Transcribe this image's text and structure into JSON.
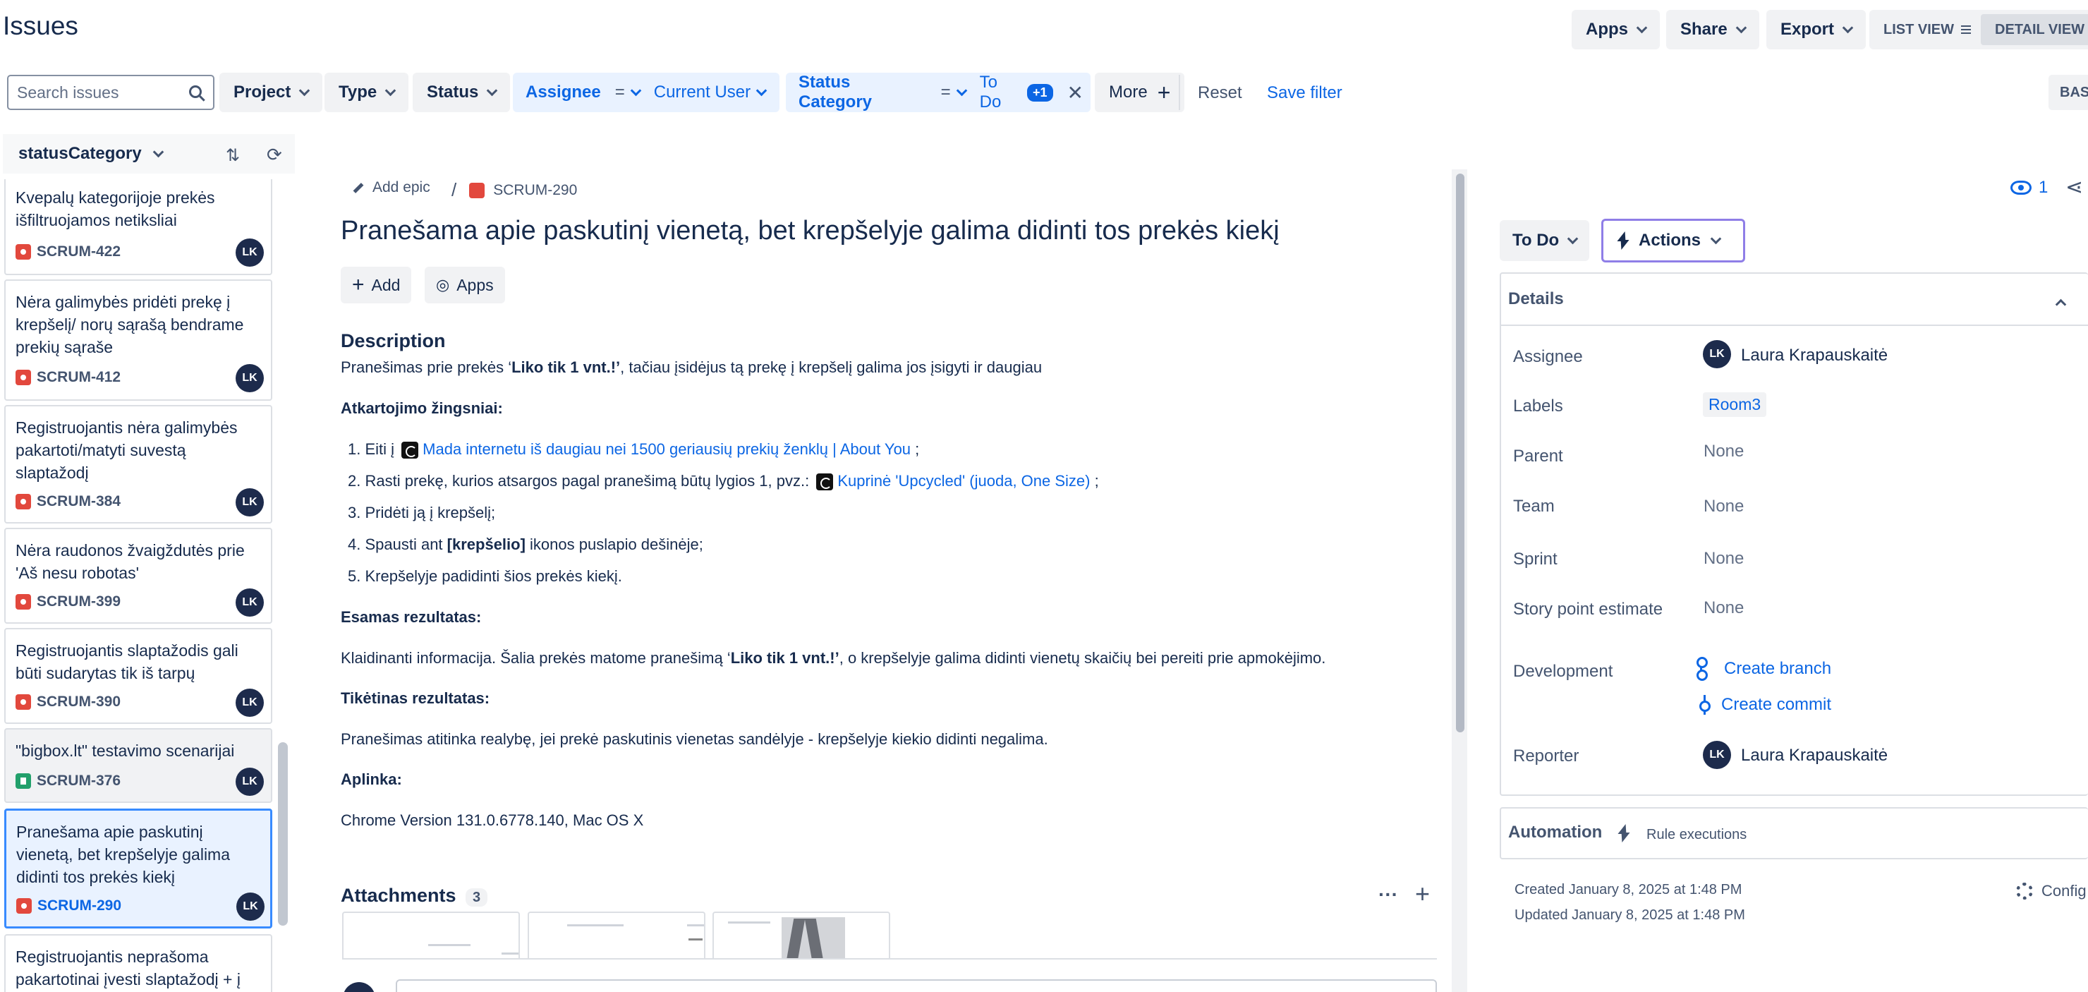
{
  "header": {
    "title": "Issues",
    "apps": "Apps",
    "share": "Share",
    "export": "Export",
    "list_view": "LIST VIEW",
    "detail_view": "DETAIL VIEW"
  },
  "filters": {
    "search_placeholder": "Search issues",
    "project": "Project",
    "type": "Type",
    "status": "Status",
    "assignee_field": "Assignee",
    "assignee_op": "=",
    "assignee_value": "Current User",
    "statuscat_field": "Status Category",
    "statuscat_op": "=",
    "statuscat_value": "To Do",
    "statuscat_more": "+1",
    "more": "More",
    "reset": "Reset",
    "save_filter": "Save filter",
    "basic": "BAS"
  },
  "left_panel": {
    "group_by": "statusCategory",
    "issues": [
      {
        "title": "Kvepalų kategorijoje prekės išfiltruojamos netiksliai",
        "key": "SCRUM-422",
        "type": "bug",
        "assignee": "LK"
      },
      {
        "title": "Nėra galimybės pridėti prekę į krepšelį/ norų sąrašą bendrame prekių sąraše",
        "key": "SCRUM-412",
        "type": "bug",
        "assignee": "LK"
      },
      {
        "title": "Registruojantis nėra galimybės pakartoti/matyti suvestą slaptažodį",
        "key": "SCRUM-384",
        "type": "bug",
        "assignee": "LK"
      },
      {
        "title": "Nėra raudonos žvaigždutės prie 'Aš nesu robotas'",
        "key": "SCRUM-399",
        "type": "bug",
        "assignee": "LK"
      },
      {
        "title": "Registruojantis slaptažodis gali būti sudarytas tik iš tarpų",
        "key": "SCRUM-390",
        "type": "bug",
        "assignee": "LK"
      },
      {
        "title": "\"bigbox.lt\" testavimo scenarijai",
        "key": "SCRUM-376",
        "type": "story",
        "assignee": "LK"
      },
      {
        "title": "Pranešama apie paskutinį vienetą, bet krepšelyje galima didinti tos prekės kiekį",
        "key": "SCRUM-290",
        "type": "bug",
        "assignee": "LK"
      },
      {
        "title": "Registruojantis neprašoma pakartotinai įvesti slaptažodį + į",
        "key": "",
        "type": "bug",
        "assignee": ""
      }
    ]
  },
  "issue": {
    "add_epic": "Add epic",
    "separator": "/",
    "key": "SCRUM-290",
    "title": "Pranešama apie paskutinį vienetą, bet krepšelyje galima didinti tos prekės kiekį",
    "add_btn": "Add",
    "apps_btn": "Apps",
    "description_heading": "Description",
    "desc_p1_a": "Pranešimas prie prekės ‘",
    "desc_p1_b": "Liko tik 1 vnt.!’",
    "desc_p1_c": ", tačiau įsidėjus tą prekę į krepšelį galima jos įsigyti ir daugiau",
    "steps_heading": "Atkartojimo žingsniai:",
    "step1_a": "Eiti į",
    "step1_link": "Mada internetu iš daugiau nei 1500 geriausių prekių ženklų | About You",
    "step1_b": ";",
    "step2_a": "Rasti prekę, kurios atsargos pagal pranešimą būtų lygios 1, pvz.:",
    "step2_link": "Kuprinė 'Upcycled' (juoda, One Size)",
    "step2_b": ";",
    "step3": "Pridėti ją į krepšelį;",
    "step4_a": "Spausti ant ",
    "step4_b": "[krepšelio]",
    "step4_c": " ikonos puslapio dešinėje;",
    "step5": "Krepšelyje padidinti šios prekės kiekį.",
    "actual_heading": "Esamas rezultatas:",
    "actual_a": "Klaidinanti informacija. Šalia prekės matome pranešimą ‘",
    "actual_b": "Liko tik 1 vnt.!’",
    "actual_c": ", o krepšelyje galima didinti vienetų skaičių bei pereiti prie apmokėjimo.",
    "expected_heading": "Tikėtinas rezultatas:",
    "expected": "Pranešimas atitinka realybę, jei prekė paskutinis vienetas sandėlyje - krepšelyje kiekio didinti negalima.",
    "env_heading": "Aplinka:",
    "env": "Chrome Version 131.0.6778.140, Mac OS X",
    "attachments_heading": "Attachments",
    "attachments_count": "3"
  },
  "right_panel": {
    "watchers": "1",
    "status": "To Do",
    "actions": "Actions",
    "details_heading": "Details",
    "assignee_label": "Assignee",
    "assignee_value": "Laura Krapauskaitė",
    "assignee_initials": "LK",
    "labels_label": "Labels",
    "labels_value": "Room3",
    "parent_label": "Parent",
    "parent_value": "None",
    "team_label": "Team",
    "team_value": "None",
    "sprint_label": "Sprint",
    "sprint_value": "None",
    "story_points_label": "Story point estimate",
    "story_points_value": "None",
    "development_label": "Development",
    "create_branch": "Create branch",
    "create_commit": "Create commit",
    "reporter_label": "Reporter",
    "reporter_value": "Laura Krapauskaitė",
    "reporter_initials": "LK",
    "automation_heading": "Automation",
    "rule_executions": "Rule executions",
    "created": "Created January 8, 2025 at 1:48 PM",
    "updated": "Updated January 8, 2025 at 1:48 PM",
    "configure": "Config"
  },
  "colors": {
    "accent": "#0c66e4",
    "bug": "#e2483d",
    "story": "#22a06b",
    "selected_bg": "#e9f2ff"
  }
}
